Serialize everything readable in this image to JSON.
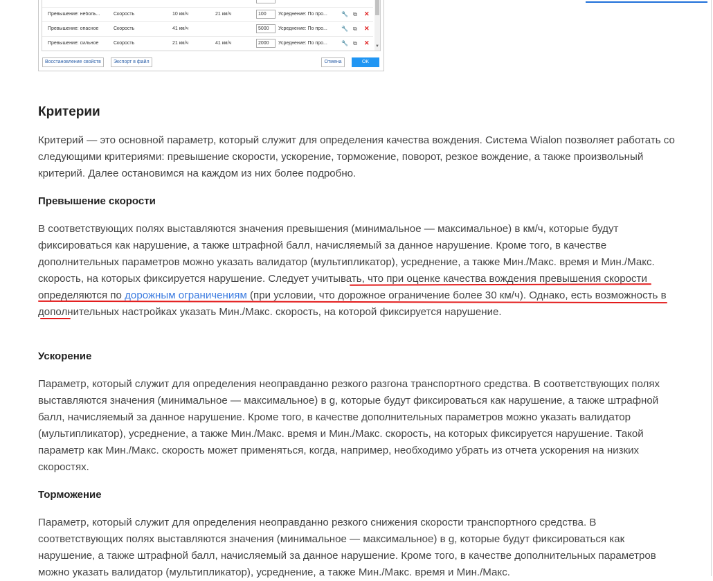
{
  "dialog": {
    "rows": [
      {
        "name": "Превышение: неболь...",
        "type": "Скорость",
        "min": "10 км/ч",
        "max": "21 км/ч",
        "penalty": "100",
        "desc": "Усреднение: По про..."
      },
      {
        "name": "Превышение: опасное",
        "type": "Скорость",
        "min": "41 км/ч",
        "max": "",
        "penalty": "5000",
        "desc": "Усреднение: По про..."
      },
      {
        "name": "Превышение: сильное",
        "type": "Скорость",
        "min": "21 км/ч",
        "max": "41 км/ч",
        "penalty": "2000",
        "desc": "Усреднение: По про..."
      }
    ],
    "buttons": {
      "restore": "Восстановление свойств",
      "export": "Экспорт в файл",
      "cancel": "Отмена",
      "ok": "OK"
    },
    "icons": {
      "edit": "wrench-icon",
      "copy": "copy-icon",
      "delete": "close-icon"
    }
  },
  "article": {
    "criteria_title": "Критерии",
    "criteria_text": "Критерий — это основной параметр, который служит для определения качества вождения. Система Wialon позволяет работать со следующими критериями: превышение скорости, ускорение, торможение, поворот, резкое вождение, а также произвольный критерий. Далее остановимся на каждом из них более подробно.",
    "speeding_title": "Превышение скорости",
    "speeding_text_1": "В соответствующих полях выставляются значения превышения (минимальное — максимальное) в км/ч, которые будут фиксироваться как нарушение, а также штрафной балл, начисляемый за данное нарушение. Кроме того, в качестве дополнительных параметров можно указать валидатор (мультипликатор), усреднение, а также Мин./Макс. время и Мин./Макс. скорость, на которых фиксируется нарушение. Следует учитывать, что при оценке качества вождения превышения скорости определяются по ",
    "speeding_link": "дорожным ограничениям",
    "speeding_text_2": " (при условии, что дорожное ограничение более 30 км/ч). Однако, есть возможность в дополнительных настройках указать Мин./Макс. скорость, на которой фиксируется нарушение.",
    "accel_title": "Ускорение",
    "accel_text": "Параметр, который служит для определения неоправданно резкого разгона транспортного средства. В соответствующих полях выставляются значения (минимальное — максимальное) в g, которые будут фиксироваться как нарушение, а также штрафной балл, начисляемый за данное нарушение. Кроме того, в качестве дополнительных параметров можно указать валидатор (мультипликатор), усреднение, а также Мин./Макс. время и Мин./Макс. скорость, на которых фиксируется нарушение. Такой параметр как Мин./Макс. скорость может применяться, когда, например, необходимо убрать из отчета ускорения на низких скоростях.",
    "brake_title": "Торможение",
    "brake_text": "Параметр, который служит для определения неоправданно резкого снижения скорости транспортного средства. В соответствующих полях выставляются значения (минимальное — максимальное) в g, которые будут фиксироваться как нарушение, а также штрафной балл, начисляемый за данное нарушение. Кроме того, в качестве дополнительных параметров можно указать валидатор (мультипликатор), усреднение, а также Мин./Макс. время и Мин./Макс."
  },
  "colors": {
    "link": "#3b7be0",
    "highlight": "#e31b1b",
    "ok_button": "#2196f3",
    "delete": "#e02020"
  }
}
